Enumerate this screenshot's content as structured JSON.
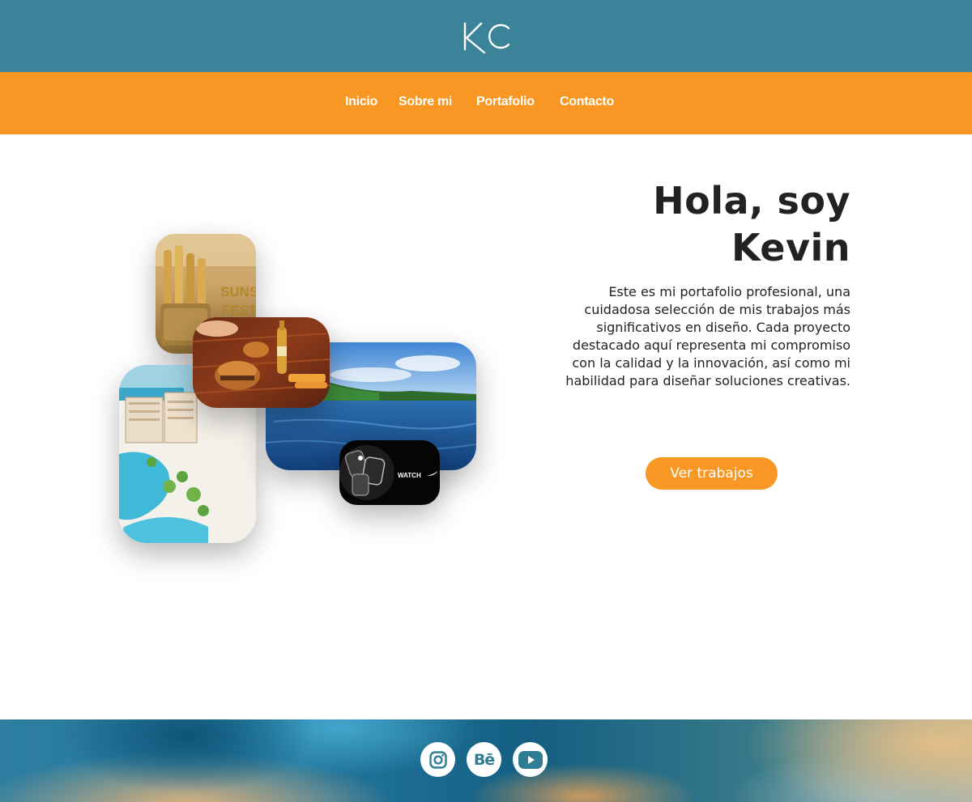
{
  "brand": {
    "logo_text": "KC",
    "color_primary": "#3a8399",
    "color_accent": "#f89723"
  },
  "nav": {
    "items": [
      {
        "label": "Inicio"
      },
      {
        "label": "Sobre mi"
      },
      {
        "label": "Portafolio"
      },
      {
        "label": "Contacto"
      }
    ]
  },
  "hero": {
    "title_line1": "Hola, soy",
    "title_line2": "Kevin",
    "description": "Este es mi portafolio profesional, una cuidadosa selección de mis trabajos más significativos en diseño. Cada proyecto destacado aquí representa mi compromiso con la calidad y la innovación, así como mi habilidad para diseñar soluciones creativas.",
    "cta_label": "Ver trabajos"
  },
  "collage": {
    "beer_poster_text_1": "SUNS",
    "beer_poster_text_2": "FEST",
    "watch_text": "WATCH"
  },
  "footer": {
    "social": [
      {
        "name": "instagram-icon"
      },
      {
        "name": "behance-icon",
        "glyph": "Bē"
      },
      {
        "name": "youtube-icon"
      }
    ]
  }
}
